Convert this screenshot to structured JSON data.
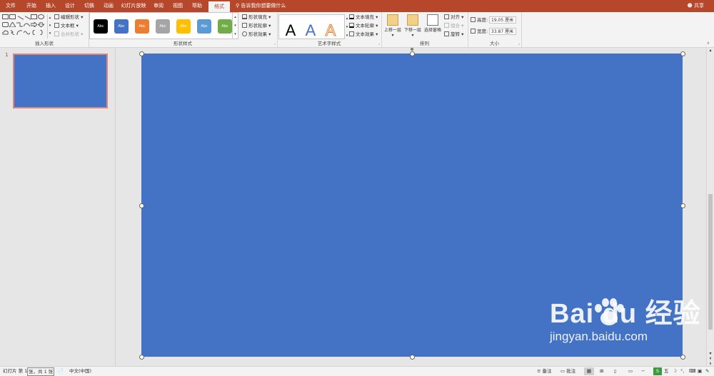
{
  "tabs": [
    "文件",
    "开始",
    "插入",
    "设计",
    "切换",
    "动画",
    "幻灯片放映",
    "审阅",
    "视图",
    "帮助",
    "格式"
  ],
  "tell_me": "告诉我你想要做什么",
  "share": "共享",
  "ribbon": {
    "insert_shapes": {
      "label": "插入形状",
      "edit_shape": "编辑形状",
      "text_box": "文本框",
      "merge_shapes": "合并形状"
    },
    "shape_styles": {
      "label": "形状样式",
      "swatch_text": "Abc",
      "swatches": [
        "#000000",
        "#4472c4",
        "#ed7d31",
        "#a5a5a5",
        "#ffc000",
        "#5b9bd5",
        "#70ad47"
      ],
      "fill": "形状填充",
      "outline": "形状轮廓",
      "effects": "形状效果"
    },
    "wordart": {
      "label": "艺术字样式",
      "letter": "A",
      "text_fill": "文本填充",
      "text_outline": "文本轮廓",
      "text_effects": "文本效果"
    },
    "arrange": {
      "label": "排列",
      "bring_forward": "上移一层",
      "send_backward": "下移一层",
      "selection_pane": "选择窗格",
      "align": "对齐",
      "group": "组合",
      "rotate": "旋转"
    },
    "size": {
      "label": "大小",
      "height_label": "高度:",
      "height_value": "19.05 厘米",
      "width_label": "宽度:",
      "width_value": "33.87 厘米"
    }
  },
  "thumbnail": {
    "number": "1",
    "fill": "#4472c4"
  },
  "slide": {
    "fill": "#4472c4"
  },
  "watermark": {
    "brand": "Bai du 经验",
    "site": "jingyan.baidu.com"
  },
  "statusbar": {
    "slide_info_1": "幻灯片 第 1",
    "slide_info_2": "张，共 1 张",
    "language": "中文(中国)",
    "notes": "备注",
    "comments": "批注"
  },
  "colors": {
    "accent": "#b7472a",
    "slide": "#4472c4"
  }
}
